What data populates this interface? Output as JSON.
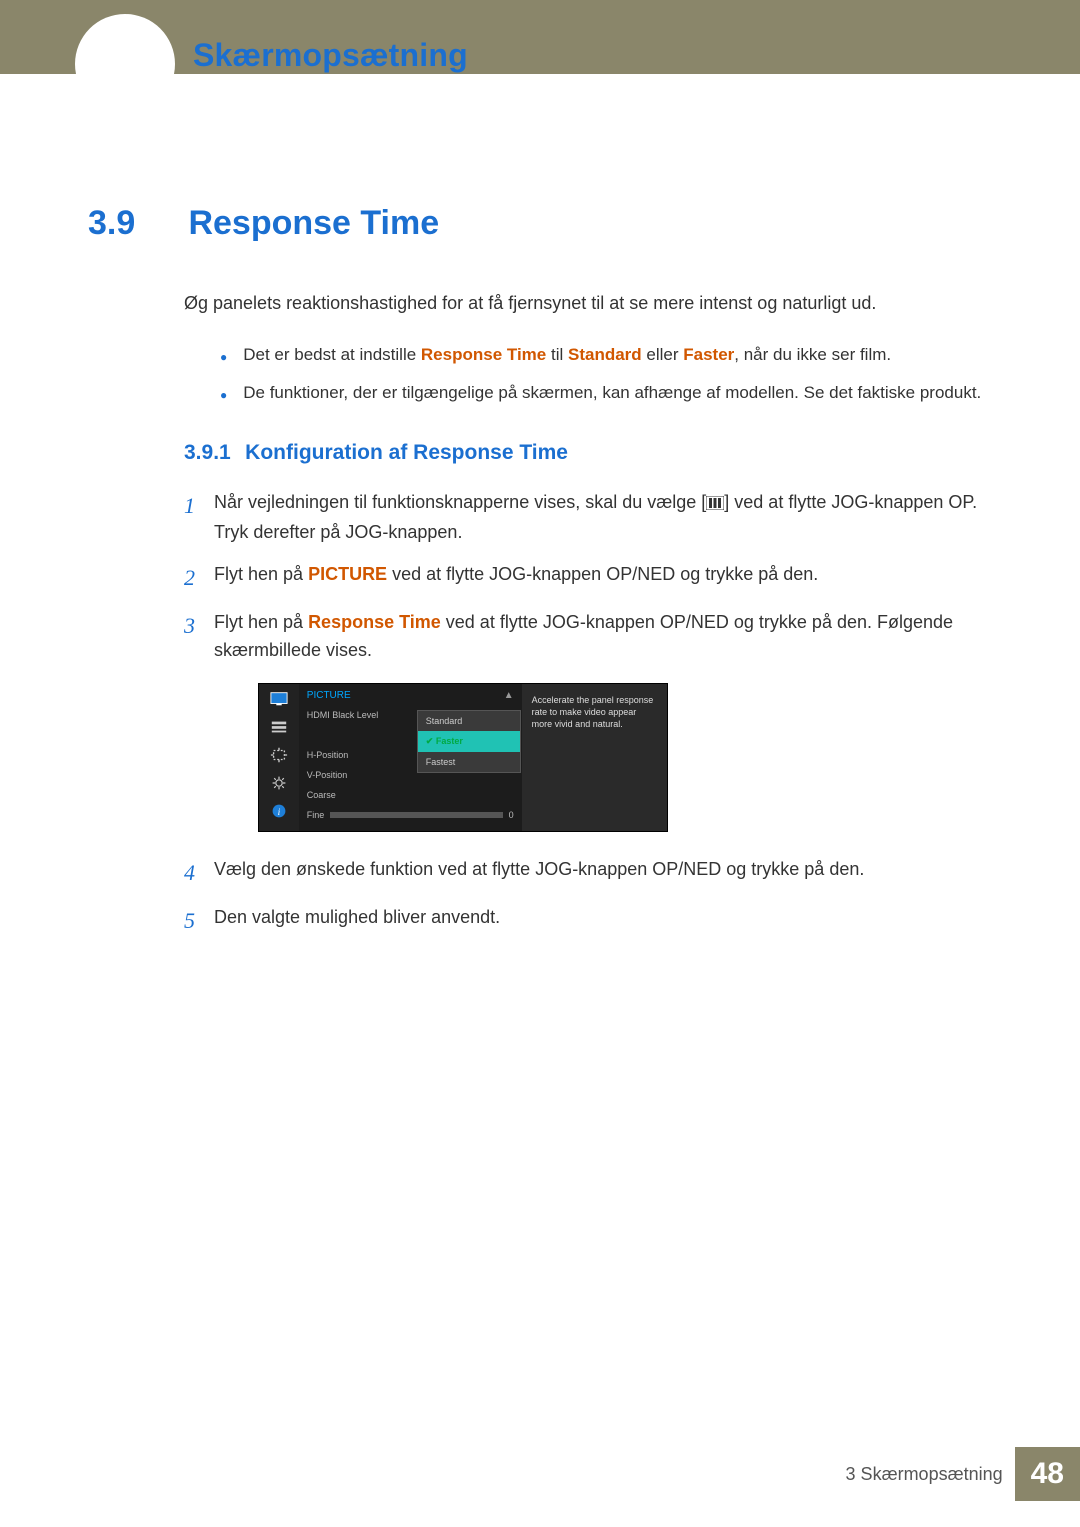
{
  "chapter": {
    "title": "Skærmopsætning"
  },
  "section": {
    "num": "3.9",
    "title": "Response Time"
  },
  "intro": "Øg panelets reaktionshastighed for at få fjernsynet til at se mere intenst og naturligt ud.",
  "bullets": {
    "b1_pre": "Det er bedst at indstille ",
    "b1_h1": "Response Time",
    "b1_mid1": " til ",
    "b1_h2": "Standard",
    "b1_mid2": " eller ",
    "b1_h3": "Faster",
    "b1_post": ", når du ikke ser film.",
    "b2": "De funktioner, der er tilgængelige på skærmen, kan afhænge af modellen. Se det faktiske produkt."
  },
  "subsection": {
    "num": "3.9.1",
    "title": "Konfiguration af Response Time"
  },
  "steps": {
    "s1a": "Når vejledningen til funktionsknapperne vises, skal du vælge [",
    "s1b": "] ved at flytte JOG-knappen OP. Tryk derefter på JOG-knappen.",
    "s2a": "Flyt hen på ",
    "s2h": "PICTURE",
    "s2b": " ved at flytte JOG-knappen OP/NED og trykke på den.",
    "s3a": "Flyt hen på ",
    "s3h": "Response Time",
    "s3b": " ved at flytte JOG-knappen OP/NED og trykke på den. Følgende skærmbillede vises.",
    "s4": "Vælg den ønskede funktion ved at flytte JOG-knappen OP/NED og trykke på den.",
    "s5": "Den valgte mulighed bliver anvendt."
  },
  "osd": {
    "title": "PICTURE",
    "items": {
      "hdmi": "HDMI Black Level",
      "hpos": "H-Position",
      "vpos": "V-Position",
      "coarse": "Coarse",
      "fine": "Fine"
    },
    "fine_val": "0",
    "options": {
      "o1": "Standard",
      "o2": "Faster",
      "o3": "Fastest"
    },
    "help": "Accelerate the panel response rate to make video appear more vivid and natural."
  },
  "footer": {
    "text": "3 Skærmopsætning",
    "page": "48"
  }
}
